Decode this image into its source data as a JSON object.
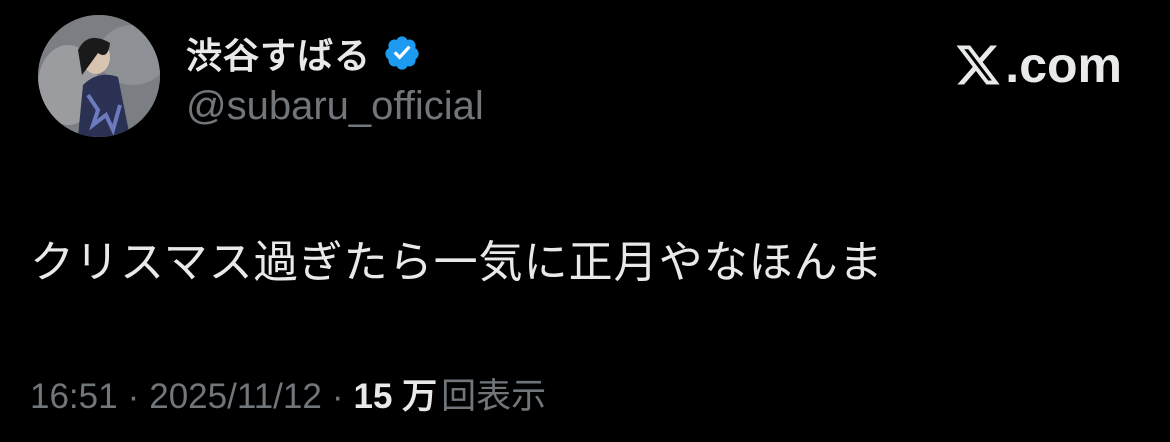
{
  "post": {
    "author": {
      "display_name": "渋谷すばる",
      "handle": "@subaru_official",
      "verified": true,
      "verified_color": "#1d9bf0",
      "avatar_icon": "profile-photo"
    },
    "brand": {
      "label": ".com",
      "icon": "x-logo-icon"
    },
    "text": "クリスマス過ぎたら一気に正月やなほんま",
    "meta": {
      "time": "16:51",
      "separator": "·",
      "date": "2025/11/12",
      "views_count": "15 万",
      "views_label": "回表示"
    }
  }
}
